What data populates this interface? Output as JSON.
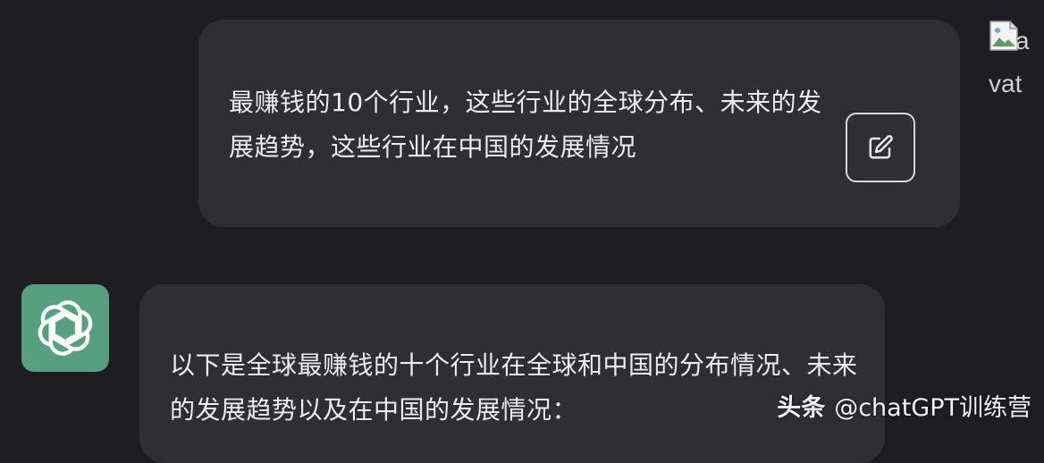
{
  "user_message": {
    "text": "最赚钱的10个行业，这些行业的全球分布、未来的发展趋势，这些行业在中国的发展情况",
    "edit_icon": "edit-icon"
  },
  "user_avatar": {
    "alt_text_a": "a",
    "alt_text_vat": "vat",
    "icon": "broken-image-icon"
  },
  "assistant_avatar": {
    "icon": "openai-logo-icon",
    "color": "#56a081"
  },
  "assistant_message": {
    "text": "以下是全球最赚钱的十个行业在全球和中国的分布情况、未来的发展趋势以及在中国的发展情况："
  },
  "watermark": {
    "brand": "头条",
    "handle": "@chatGPT训练营"
  },
  "colors": {
    "background": "#1e1e22",
    "bubble": "#2e2e33",
    "text": "#ececf0",
    "accent": "#56a081"
  }
}
